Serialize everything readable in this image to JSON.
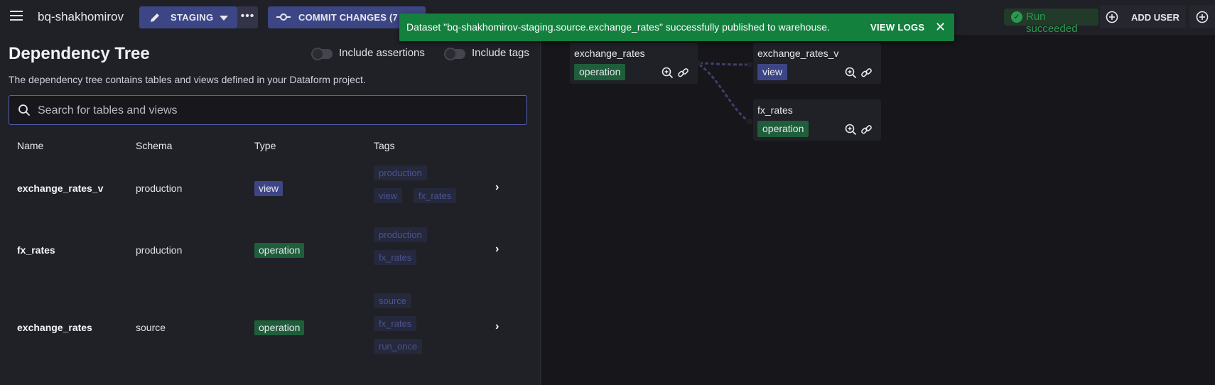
{
  "header": {
    "project_name": "bq-shakhomirov",
    "branch_label": "STAGING",
    "more_label": "•••",
    "commit_label": "COMMIT CHANGES (7 FIL",
    "run_status": "Run succeeded",
    "add_user_label": "ADD USER"
  },
  "toast": {
    "message": "Dataset \"bq-shakhomirov-staging.source.exchange_rates\" successfully published to warehouse.",
    "action_label": "VIEW LOGS",
    "close_label": "✕"
  },
  "panel": {
    "title": "Dependency Tree",
    "toggle_assertions": "Include assertions",
    "toggle_tags": "Include tags",
    "description": "The dependency tree contains tables and views defined in your Dataform project.",
    "search_placeholder": "Search for tables and views"
  },
  "table": {
    "headers": [
      "Name",
      "Schema",
      "Type",
      "Tags"
    ],
    "rows": [
      {
        "name": "exchange_rates_v",
        "schema": "production",
        "type": "view",
        "tags": [
          "production",
          "view",
          "fx_rates"
        ]
      },
      {
        "name": "fx_rates",
        "schema": "production",
        "type": "operation",
        "tags": [
          "production",
          "fx_rates"
        ]
      },
      {
        "name": "exchange_rates",
        "schema": "source",
        "type": "operation",
        "tags": [
          "source",
          "fx_rates",
          "run_once"
        ]
      }
    ],
    "chevron": "›"
  },
  "graph": {
    "nodes": [
      {
        "name": "exchange_rates",
        "type": "operation"
      },
      {
        "name": "exchange_rates_v",
        "type": "view"
      },
      {
        "name": "fx_rates",
        "type": "operation"
      }
    ]
  },
  "colors": {
    "accent": "#3d4685",
    "operation": "#1e5e3a",
    "success": "#13803e",
    "background": "#202027"
  }
}
